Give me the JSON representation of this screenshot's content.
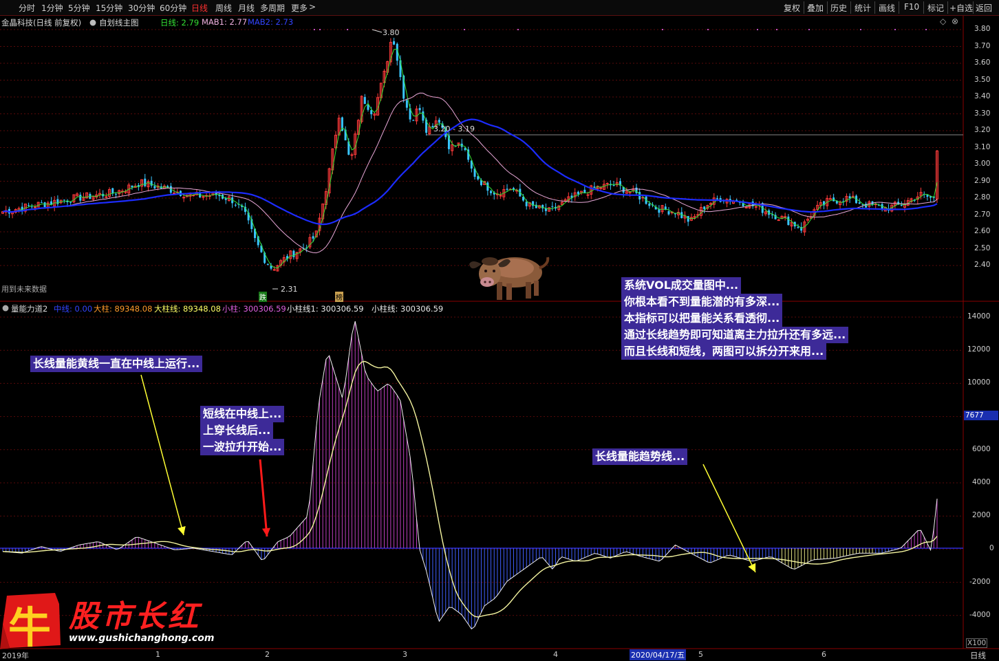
{
  "toolbar": {
    "periods": [
      "分时",
      "1分钟",
      "5分钟",
      "15分钟",
      "30分钟",
      "60分钟",
      "日线",
      "周线",
      "月线",
      "多周期",
      "更多"
    ],
    "active": "日线",
    "right": [
      "复权",
      "叠加",
      "历史",
      "统计",
      "画线",
      "F10",
      "标记",
      "+自选",
      "返回"
    ]
  },
  "title": {
    "stock": "金晶科技(日线 前复权)",
    "formula": "自划线主图",
    "rixian_label": "日线: 2.79",
    "mab1_label": "MAB1: 2.77",
    "mab2_label": "MAB2: 2.73"
  },
  "price_labels": {
    "high": "3.80",
    "low": "2.31",
    "mid": "3.20 - 3.19"
  },
  "price_markers": {
    "die": "跌",
    "bang": "榜"
  },
  "future_note": "用到未来数据",
  "indicator": {
    "name": "量能力道2",
    "zhongxian": "中线: 0.00",
    "dazhu": "大柱: 89348.08",
    "dazhuxian": "大柱线: 89348.08",
    "xiaozhu": "小柱: 300306.59",
    "xiaozhuxian1": "小柱线1: 300306.59",
    "xiaozhuxian": "小柱线: 300306.59"
  },
  "price_axis": [
    "3.80",
    "3.70",
    "3.60",
    "3.50",
    "3.40",
    "3.30",
    "3.20",
    "3.10",
    "3.00",
    "2.90",
    "2.80",
    "2.70",
    "2.60",
    "2.50",
    "2.40"
  ],
  "vol_axis": [
    "14000",
    "12000",
    "10000",
    "8000",
    "6000",
    "4000",
    "2000",
    "0",
    "-2000",
    "-4000"
  ],
  "vol_current": "7677",
  "vol_scale": "X100",
  "date_axis": [
    "2019年",
    "1",
    "2",
    "3",
    "4",
    "2020/04/17/五",
    "5",
    "6"
  ],
  "bottom_right": "日线",
  "annotations": {
    "a1": "长线量能黄线一直在中线上运行...",
    "a2": [
      "短线在中线上...",
      "上穿长线后...",
      "一波拉升开始..."
    ],
    "a3": "长线量能趋势线...",
    "a4": [
      "系统VOL成交量图中...",
      "你根本看不到量能潜的有多深...",
      "本指标可以把量能关系看透彻...",
      "通过长线趋势即可知道离主力拉升还有多远...",
      "而且长线和短线，两图可以拆分开来用..."
    ]
  },
  "logo": {
    "big": "股市长红",
    "url": "www.gushichanghong.com",
    "char": "牛"
  },
  "colors": {
    "up": "#ff3b3b",
    "down": "#39c6ff",
    "mab_pink": "#e8a8d8",
    "mab_blue": "#1c2cff",
    "rixian": "#34e034",
    "annbg": "#3d2a98",
    "yellow": "#ffff33"
  },
  "chart_data": [
    {
      "type": "line",
      "title": "金晶科技(日线 前复权)",
      "series": [
        {
          "name": "日线",
          "last": 2.79
        },
        {
          "name": "MAB1",
          "last": 2.77
        },
        {
          "name": "MAB2",
          "last": 2.73
        }
      ],
      "ylim": [
        2.31,
        3.85
      ],
      "annotated_points": {
        "high": 3.8,
        "low": 2.31,
        "hline": 3.2
      }
    },
    {
      "type": "bar",
      "title": "量能力道2",
      "series": [
        {
          "name": "中线",
          "last": 0
        },
        {
          "name": "大柱",
          "last": 89348.08
        },
        {
          "name": "小柱",
          "last": 300306.59
        }
      ],
      "ylim": [
        -4500,
        14500
      ],
      "scale": "X100"
    }
  ]
}
